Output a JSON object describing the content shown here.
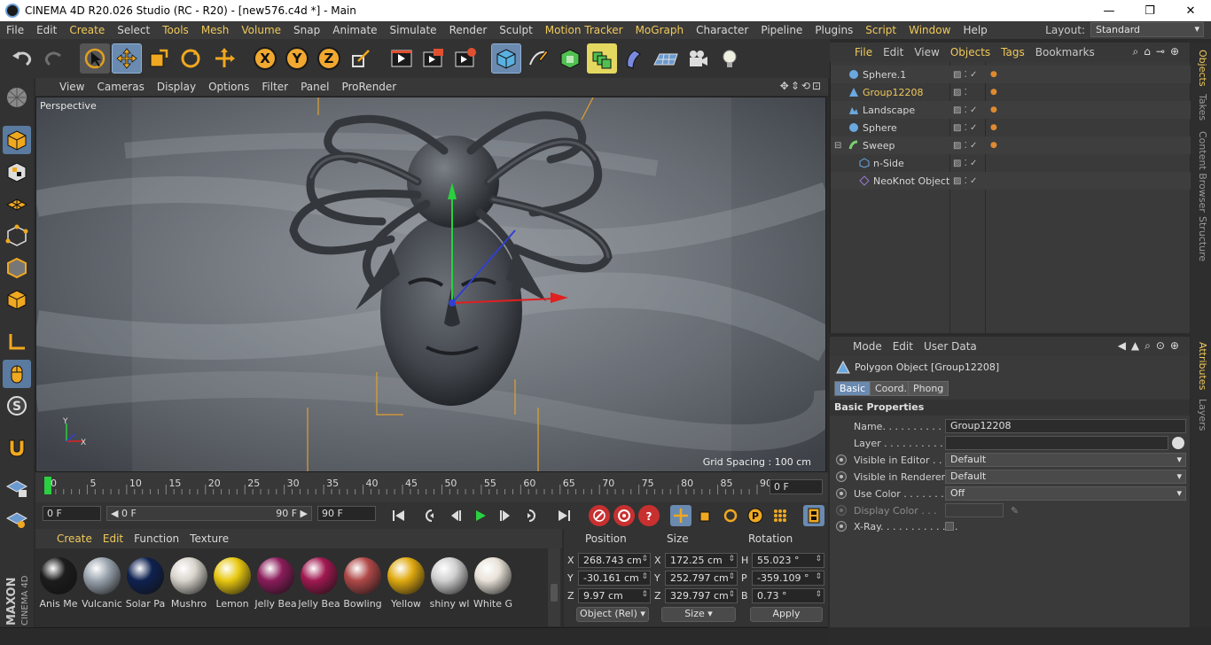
{
  "window": {
    "title": "CINEMA 4D R20.026 Studio (RC - R20) - [new576.c4d *] - Main",
    "minimize": "—",
    "maximize": "❐",
    "close": "✕"
  },
  "menubar": {
    "items": [
      "File",
      "Edit",
      "Create",
      "Select",
      "Tools",
      "Mesh",
      "Volume",
      "Snap",
      "Animate",
      "Simulate",
      "Render",
      "Sculpt",
      "Motion Tracker",
      "MoGraph",
      "Character",
      "Pipeline",
      "Plugins",
      "Script",
      "Window",
      "Help"
    ],
    "highlighted": [
      "Create",
      "Tools",
      "Mesh",
      "Volume",
      "Motion Tracker",
      "MoGraph",
      "Script",
      "Window"
    ],
    "layout_label": "Layout:",
    "layout_value": "Standard"
  },
  "toolbar": {
    "axis_x": "X",
    "axis_y": "Y",
    "axis_z": "Z"
  },
  "viewport": {
    "menu": [
      "View",
      "Cameras",
      "Display",
      "Options",
      "Filter",
      "Panel",
      "ProRender"
    ],
    "controls": "✥⇕⟲⊡",
    "label": "Perspective",
    "grid_spacing": "Grid Spacing : 100 cm"
  },
  "timeline": {
    "ticks": [
      "0",
      "5",
      "10",
      "15",
      "20",
      "25",
      "30",
      "35",
      "40",
      "45",
      "50",
      "55",
      "60",
      "65",
      "70",
      "75",
      "80",
      "85",
      "90"
    ],
    "current_frame": "0 F"
  },
  "transport": {
    "start": "0 F",
    "range_start": "◀ 0 F",
    "range_end": "90 F ▶",
    "end": "90 F"
  },
  "materials": {
    "menu": [
      "Create",
      "Edit",
      "Function",
      "Texture"
    ],
    "items": [
      {
        "name": "Anis Me",
        "color": "#1c1c1c"
      },
      {
        "name": "Vulcanic",
        "color": "#9aa4ae"
      },
      {
        "name": "Solar Pa",
        "color": "#0e2150"
      },
      {
        "name": "Mushro",
        "color": "#d8d4cc"
      },
      {
        "name": "Lemon",
        "color": "#e8c810"
      },
      {
        "name": "Jelly Bea",
        "color": "#8a1c5a"
      },
      {
        "name": "Jelly Bea",
        "color": "#a01850"
      },
      {
        "name": "Bowling",
        "color": "#b04848"
      },
      {
        "name": "Yellow",
        "color": "#e0aa10"
      },
      {
        "name": "shiny wl",
        "color": "#d0d0d0"
      },
      {
        "name": "White G",
        "color": "#e8e2d8"
      }
    ]
  },
  "coordinates": {
    "headers": [
      "Position",
      "Size",
      "Rotation"
    ],
    "rows": [
      {
        "axis": "X",
        "pos": "268.743 cm",
        "size_axis": "X",
        "size": "172.25 cm",
        "rot_axis": "H",
        "rot": "55.023 °"
      },
      {
        "axis": "Y",
        "pos": "-30.161 cm",
        "size_axis": "Y",
        "size": "252.797 cm",
        "rot_axis": "P",
        "rot": "-359.109 °"
      },
      {
        "axis": "Z",
        "pos": "9.97 cm",
        "size_axis": "Z",
        "size": "329.797 cm",
        "rot_axis": "B",
        "rot": "0.73 °"
      }
    ],
    "mode_select": "Object (Rel)",
    "size_select": "Size",
    "apply": "Apply"
  },
  "objects": {
    "menu": [
      "File",
      "Edit",
      "View",
      "Objects",
      "Tags",
      "Bookmarks"
    ],
    "highlighted": [
      "File",
      "Objects",
      "Tags"
    ],
    "tree": [
      {
        "name": "Sphere.1",
        "indent": 0,
        "icon": "sphere-icon",
        "color": "#6aa8e0",
        "check": true,
        "tag": true,
        "hl": false
      },
      {
        "name": "Group12208",
        "indent": 0,
        "icon": "polygon-icon",
        "color": "#6aa8e0",
        "check": false,
        "tag": true,
        "hl": true
      },
      {
        "name": "Landscape",
        "indent": 0,
        "icon": "landscape-icon",
        "color": "#6aa8e0",
        "check": true,
        "tag": true,
        "hl": false
      },
      {
        "name": "Sphere",
        "indent": 0,
        "icon": "sphere-icon",
        "color": "#6aa8e0",
        "check": true,
        "tag": true,
        "hl": false
      },
      {
        "name": "Sweep",
        "indent": 0,
        "icon": "sweep-icon",
        "color": "#7ad070",
        "check": true,
        "tag": true,
        "hl": false
      },
      {
        "name": "n-Side",
        "indent": 1,
        "icon": "nside-icon",
        "color": "#6aa8e0",
        "check": true,
        "tag": false,
        "hl": false
      },
      {
        "name": "NeoKnot Object",
        "indent": 1,
        "icon": "neoknot-icon",
        "color": "#9a7ad0",
        "check": true,
        "tag": false,
        "hl": false
      }
    ]
  },
  "attributes": {
    "menu": [
      "Mode",
      "Edit",
      "User Data"
    ],
    "title": "Polygon Object [Group12208]",
    "tabs": [
      "Basic",
      "Coord.",
      "Phong"
    ],
    "section": "Basic Properties",
    "name_label": "Name. . . . . . . . . . . . .",
    "name_value": "Group12208",
    "layer_label": "Layer . . . . . . . . . . . . .",
    "visible_editor_label": "Visible in Editor . . .",
    "visible_editor_value": "Default",
    "visible_renderer_label": "Visible in Renderer",
    "visible_renderer_value": "Default",
    "use_color_label": "Use Color . . . . . . . .",
    "use_color_value": "Off",
    "display_color_label": "Display Color . . .",
    "xray_label": "X-Ray. . . . . . . . . . . . ."
  },
  "sidetabs": {
    "top": [
      "Objects",
      "Takes",
      "Content Browser",
      "Structure"
    ],
    "bottom": [
      "Attributes",
      "Layers"
    ]
  },
  "branding": {
    "maxon": "MAXON",
    "cinema": "CINEMA 4D"
  }
}
